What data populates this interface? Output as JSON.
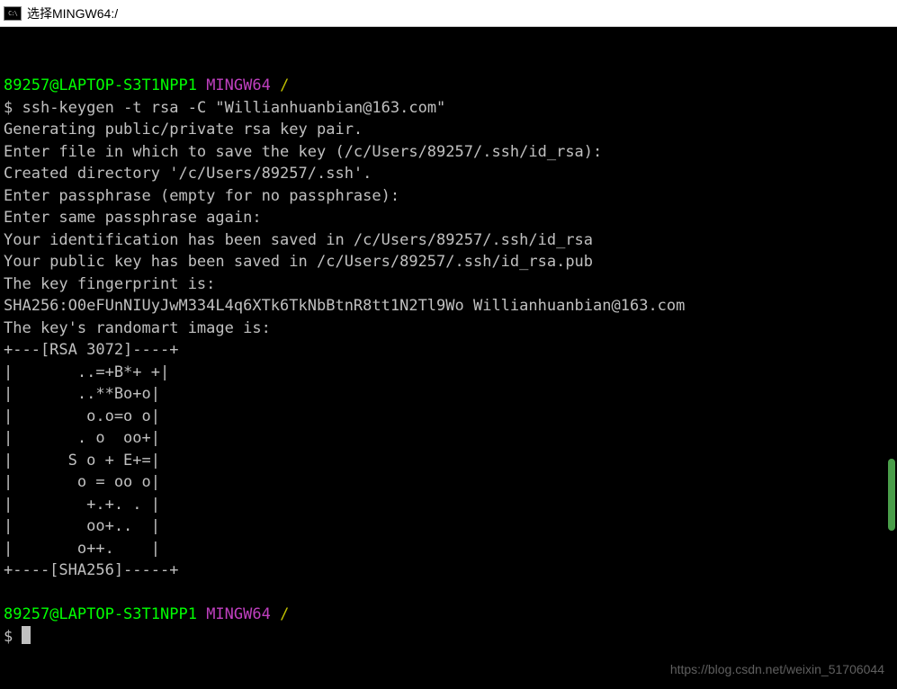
{
  "titlebar": {
    "icon_text": "C:\\",
    "title": "选择MINGW64:/"
  },
  "prompt1": {
    "user_host": "89257@LAPTOP-S3T1NPP1",
    "mingw": "MINGW64",
    "path": "/"
  },
  "command1": {
    "prompt": "$ ",
    "text": "ssh-keygen -t rsa -C \"Willianhuanbian@163.com\""
  },
  "output": {
    "l1": "Generating public/private rsa key pair.",
    "l2": "Enter file in which to save the key (/c/Users/89257/.ssh/id_rsa):",
    "l3": "Created directory '/c/Users/89257/.ssh'.",
    "l4": "Enter passphrase (empty for no passphrase):",
    "l5": "Enter same passphrase again:",
    "l6": "Your identification has been saved in /c/Users/89257/.ssh/id_rsa",
    "l7": "Your public key has been saved in /c/Users/89257/.ssh/id_rsa.pub",
    "l8": "The key fingerprint is:",
    "l9": "SHA256:O0eFUnNIUyJwM334L4q6XTk6TkNbBtnR8tt1N2Tl9Wo Willianhuanbian@163.com",
    "l10": "The key's randomart image is:",
    "art1": "+---[RSA 3072]----+",
    "art2": "|       ..=+B*+ +|",
    "art3": "|       ..**Bo+o|",
    "art4": "|        o.o=o o|",
    "art5": "|       . o  oo+|",
    "art6": "|      S o + E+=|",
    "art7": "|       o = oo o|",
    "art8": "|        +.+. . |",
    "art9": "|        oo+..  |",
    "art10": "|       o++.    |",
    "art11": "+----[SHA256]-----+"
  },
  "prompt2": {
    "user_host": "89257@LAPTOP-S3T1NPP1",
    "mingw": "MINGW64",
    "path": "/"
  },
  "command2": {
    "prompt": "$ "
  },
  "watermark": "https://blog.csdn.net/weixin_51706044"
}
